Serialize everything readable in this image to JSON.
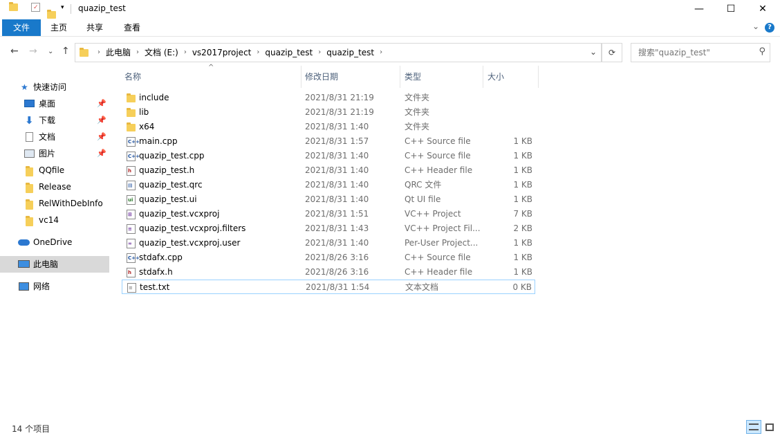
{
  "window": {
    "title": "quazip_test",
    "colors": {
      "accent": "#1979ca",
      "selection": "#cce8ff"
    }
  },
  "titlebar": {
    "minimize": "—",
    "maximize": "☐",
    "close": "✕"
  },
  "ribbon": {
    "tabs": [
      "文件",
      "主页",
      "共享",
      "查看"
    ],
    "expand": "⌄",
    "help": "?"
  },
  "nav": {
    "back": "←",
    "forward": "→",
    "recent": "⌄",
    "up": "↑"
  },
  "address": {
    "crumbs": [
      "此电脑",
      "文档 (E:)",
      "vs2017project",
      "quazip_test",
      "quazip_test"
    ],
    "dropdown": "⌄",
    "refresh": "⟳"
  },
  "search": {
    "placeholder": "搜索\"quazip_test\""
  },
  "sidebar": [
    {
      "label": "快速访问",
      "icon": "star-icon"
    },
    {
      "label": "桌面",
      "icon": "desktop-icon",
      "pinned": true
    },
    {
      "label": "下载",
      "icon": "download-icon",
      "pinned": true
    },
    {
      "label": "文档",
      "icon": "documents-icon",
      "pinned": true
    },
    {
      "label": "图片",
      "icon": "pictures-icon",
      "pinned": true
    },
    {
      "label": "QQfile",
      "icon": "folder-icon"
    },
    {
      "label": "Release",
      "icon": "folder-icon"
    },
    {
      "label": "RelWithDebInfo",
      "icon": "folder-icon"
    },
    {
      "label": "vc14",
      "icon": "folder-icon"
    },
    {
      "label": "OneDrive",
      "icon": "cloud-icon"
    },
    {
      "label": "此电脑",
      "icon": "computer-icon",
      "selected": true
    },
    {
      "label": "网络",
      "icon": "network-icon"
    }
  ],
  "columns": {
    "name": "名称",
    "date": "修改日期",
    "type": "类型",
    "size": "大小"
  },
  "files": [
    {
      "name": "include",
      "date": "2021/8/31 21:19",
      "type": "文件夹",
      "size": "",
      "kind": "folder"
    },
    {
      "name": "lib",
      "date": "2021/8/31 21:19",
      "type": "文件夹",
      "size": "",
      "kind": "folder"
    },
    {
      "name": "x64",
      "date": "2021/8/31 1:40",
      "type": "文件夹",
      "size": "",
      "kind": "folder"
    },
    {
      "name": "main.cpp",
      "date": "2021/8/31 1:57",
      "type": "C++ Source file",
      "size": "1 KB",
      "kind": "cpp"
    },
    {
      "name": "quazip_test.cpp",
      "date": "2021/8/31 1:40",
      "type": "C++ Source file",
      "size": "1 KB",
      "kind": "cpp"
    },
    {
      "name": "quazip_test.h",
      "date": "2021/8/31 1:40",
      "type": "C++ Header file",
      "size": "1 KB",
      "kind": "h"
    },
    {
      "name": "quazip_test.qrc",
      "date": "2021/8/31 1:40",
      "type": "QRC 文件",
      "size": "1 KB",
      "kind": "qrc"
    },
    {
      "name": "quazip_test.ui",
      "date": "2021/8/31 1:40",
      "type": "Qt UI file",
      "size": "1 KB",
      "kind": "ui"
    },
    {
      "name": "quazip_test.vcxproj",
      "date": "2021/8/31 1:51",
      "type": "VC++ Project",
      "size": "7 KB",
      "kind": "vcx"
    },
    {
      "name": "quazip_test.vcxproj.filters",
      "date": "2021/8/31 1:43",
      "type": "VC++ Project Fil...",
      "size": "2 KB",
      "kind": "filters"
    },
    {
      "name": "quazip_test.vcxproj.user",
      "date": "2021/8/31 1:40",
      "type": "Per-User Project...",
      "size": "1 KB",
      "kind": "user"
    },
    {
      "name": "stdafx.cpp",
      "date": "2021/8/26 3:16",
      "type": "C++ Source file",
      "size": "1 KB",
      "kind": "cpp"
    },
    {
      "name": "stdafx.h",
      "date": "2021/8/26 3:16",
      "type": "C++ Header file",
      "size": "1 KB",
      "kind": "h"
    },
    {
      "name": "test.txt",
      "date": "2021/8/31 1:54",
      "type": "文本文档",
      "size": "0 KB",
      "kind": "txt",
      "selected": true
    }
  ],
  "status": {
    "count": "14 个项目"
  }
}
